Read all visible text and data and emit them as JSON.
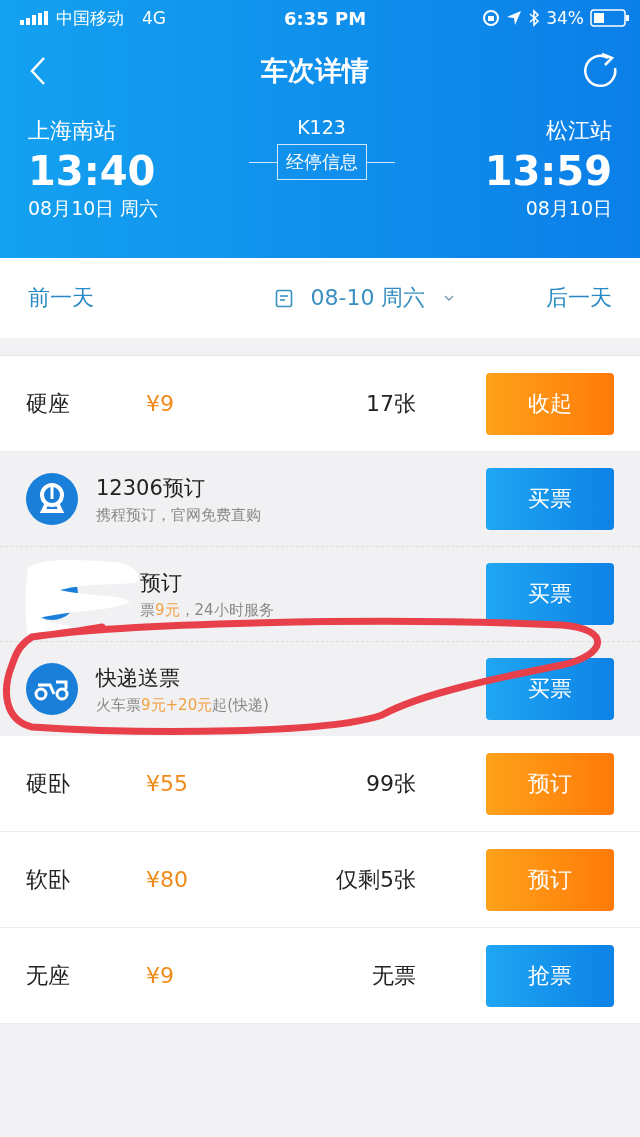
{
  "status_bar": {
    "carrier": "中国移动",
    "network": "4G",
    "time": "6:35 PM",
    "battery": "34%"
  },
  "header": {
    "title": "车次详情",
    "train": "K123",
    "stops_button": "经停信息",
    "from": {
      "station": "上海南站",
      "time": "13:40",
      "date": "08月10日 周六"
    },
    "to": {
      "station": "松江站",
      "time": "13:59",
      "date": "08月10日"
    }
  },
  "date_bar": {
    "prev": "前一天",
    "date": "08-10 周六",
    "next": "后一天"
  },
  "seats": [
    {
      "name": "硬座",
      "price": "¥9",
      "count": "17张",
      "button": {
        "label": "收起",
        "kind": "orange"
      },
      "options": [
        {
          "kind": "rail",
          "title": "12306预订",
          "subtitle": [
            {
              "kind": "plain",
              "text": "携程预订，官网免费直购"
            }
          ],
          "button": "买票"
        },
        {
          "kind": "app",
          "title": "预订",
          "subtitle": [
            {
              "kind": "plain",
              "text": "票"
            },
            {
              "kind": "price",
              "text": "9元"
            },
            {
              "kind": "plain",
              "text": "，24小时服务"
            }
          ],
          "button": "买票"
        },
        {
          "kind": "scooter",
          "title": "快递送票",
          "subtitle": [
            {
              "kind": "plain",
              "text": "火车票"
            },
            {
              "kind": "price",
              "text": "9元+20元"
            },
            {
              "kind": "plain",
              "text": "起(快递)"
            }
          ],
          "button": "买票"
        }
      ]
    },
    {
      "name": "硬卧",
      "price": "¥55",
      "count": "99张",
      "button": {
        "label": "预订",
        "kind": "orange"
      }
    },
    {
      "name": "软卧",
      "price": "¥80",
      "count": "仅剩5张",
      "button": {
        "label": "预订",
        "kind": "orange"
      }
    },
    {
      "name": "无座",
      "price": "¥9",
      "count": "无票",
      "button": {
        "label": "抢票",
        "kind": "blue"
      }
    }
  ],
  "overlays": [
    {
      "kind": "scribble"
    },
    {
      "kind": "ellipse"
    }
  ]
}
